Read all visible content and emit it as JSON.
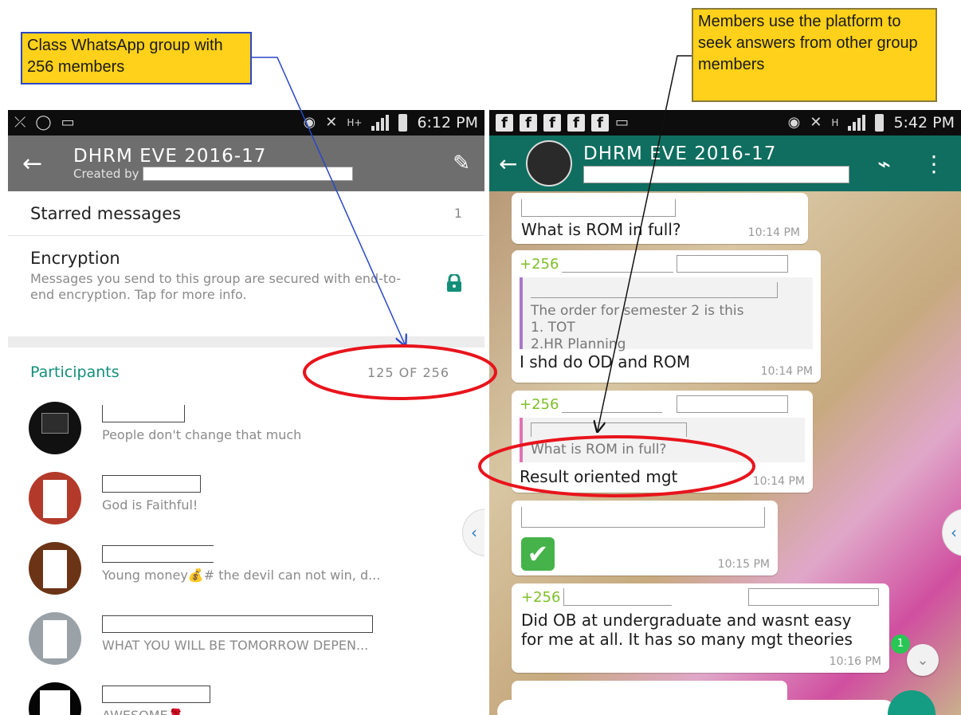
{
  "annotations": {
    "left_callout": "Class WhatsApp group with 256 members",
    "right_callout": "Members use the platform to seek answers from other group members"
  },
  "colors": {
    "callout_bg": "#ffd11a",
    "whatsapp_teal": "#0f6e5f",
    "grey_toolbar": "#6e6e6e",
    "participants_green": "#138f79",
    "ellipse": "#e8141c",
    "arrow_blue": "#2a47c8",
    "sender_green": "#7fbe2a"
  },
  "left_screen": {
    "status": {
      "time": "6:12 PM",
      "icons": [
        "missed-call-icon",
        "whatsapp-icon",
        "image-icon",
        "eye-icon",
        "mute-icon",
        "h-plus-icon",
        "signal-icon",
        "battery-icon"
      ]
    },
    "toolbar": {
      "title": "DHRM EVE 2016-17",
      "subtitle": "Created by"
    },
    "starred": {
      "label": "Starred messages",
      "count": "1"
    },
    "encryption": {
      "title": "Encryption",
      "description": "Messages you send to this group are secured with end-to-end encryption. Tap for more info."
    },
    "participants": {
      "label": "Participants",
      "count": "125 OF 256"
    },
    "members": [
      {
        "status": "People don't change that much"
      },
      {
        "status": "God  is  Faithful!"
      },
      {
        "status": "Young money💰# the devil can not win, d..."
      },
      {
        "status": "WHAT YOU WILL BE TOMORROW DEPEN..."
      },
      {
        "status": "AWESOME🌹"
      }
    ]
  },
  "right_screen": {
    "status": {
      "time": "5:42 PM"
    },
    "toolbar": {
      "title": "DHRM EVE 2016-17"
    },
    "messages": [
      {
        "text": "What is ROM in full?",
        "time": "10:14 PM"
      },
      {
        "sender": "+256",
        "quote": "The order for semester 2 is this\n1. TOT\n2.HR Planning",
        "text": "I shd do OD and ROM",
        "time": "10:14 PM"
      },
      {
        "sender": "+256",
        "quote": "What is ROM in full?",
        "text": "Result oriented mgt",
        "time": "10:14 PM"
      },
      {
        "text": "✔",
        "time": "10:15 PM"
      },
      {
        "sender": "+256",
        "text": "Did OB at undergraduate and wasnt easy for me at all. It has so many mgt theories",
        "time": "10:16 PM"
      }
    ],
    "unread_badge": "1"
  }
}
